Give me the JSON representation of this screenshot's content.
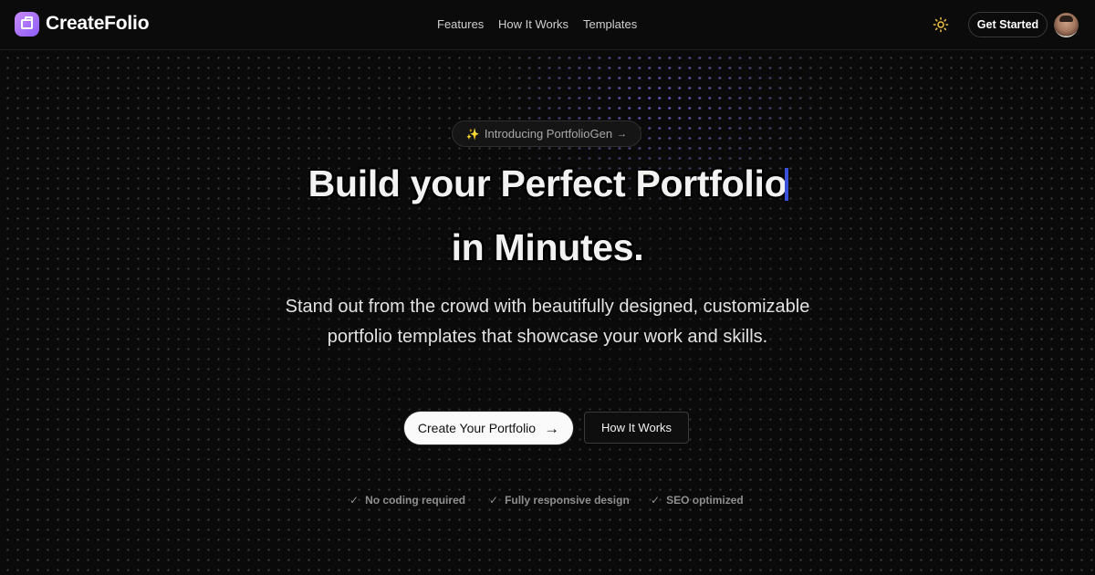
{
  "header": {
    "brand": "CreateFolio",
    "nav": [
      "Features",
      "How It Works",
      "Templates"
    ],
    "theme_icon": "sun-icon",
    "cta_label": "Get Started",
    "accent": "#8b5cf6"
  },
  "hero": {
    "badge": {
      "sparkle": "✨",
      "text": "Introducing PortfolioGen",
      "arrow": "→"
    },
    "headline_line1": "Build your Perfect Portfolio",
    "headline_line2": "in Minutes.",
    "subtitle": "Stand out from the crowd with beautifully designed, customizable portfolio templates that showcase your work and skills.",
    "primary_cta": "Create Your Portfolio",
    "secondary_cta": "How It Works",
    "features": [
      "No coding required",
      "Fully responsive design",
      "SEO optimized"
    ],
    "cursor_color": "#3b4fd8"
  }
}
